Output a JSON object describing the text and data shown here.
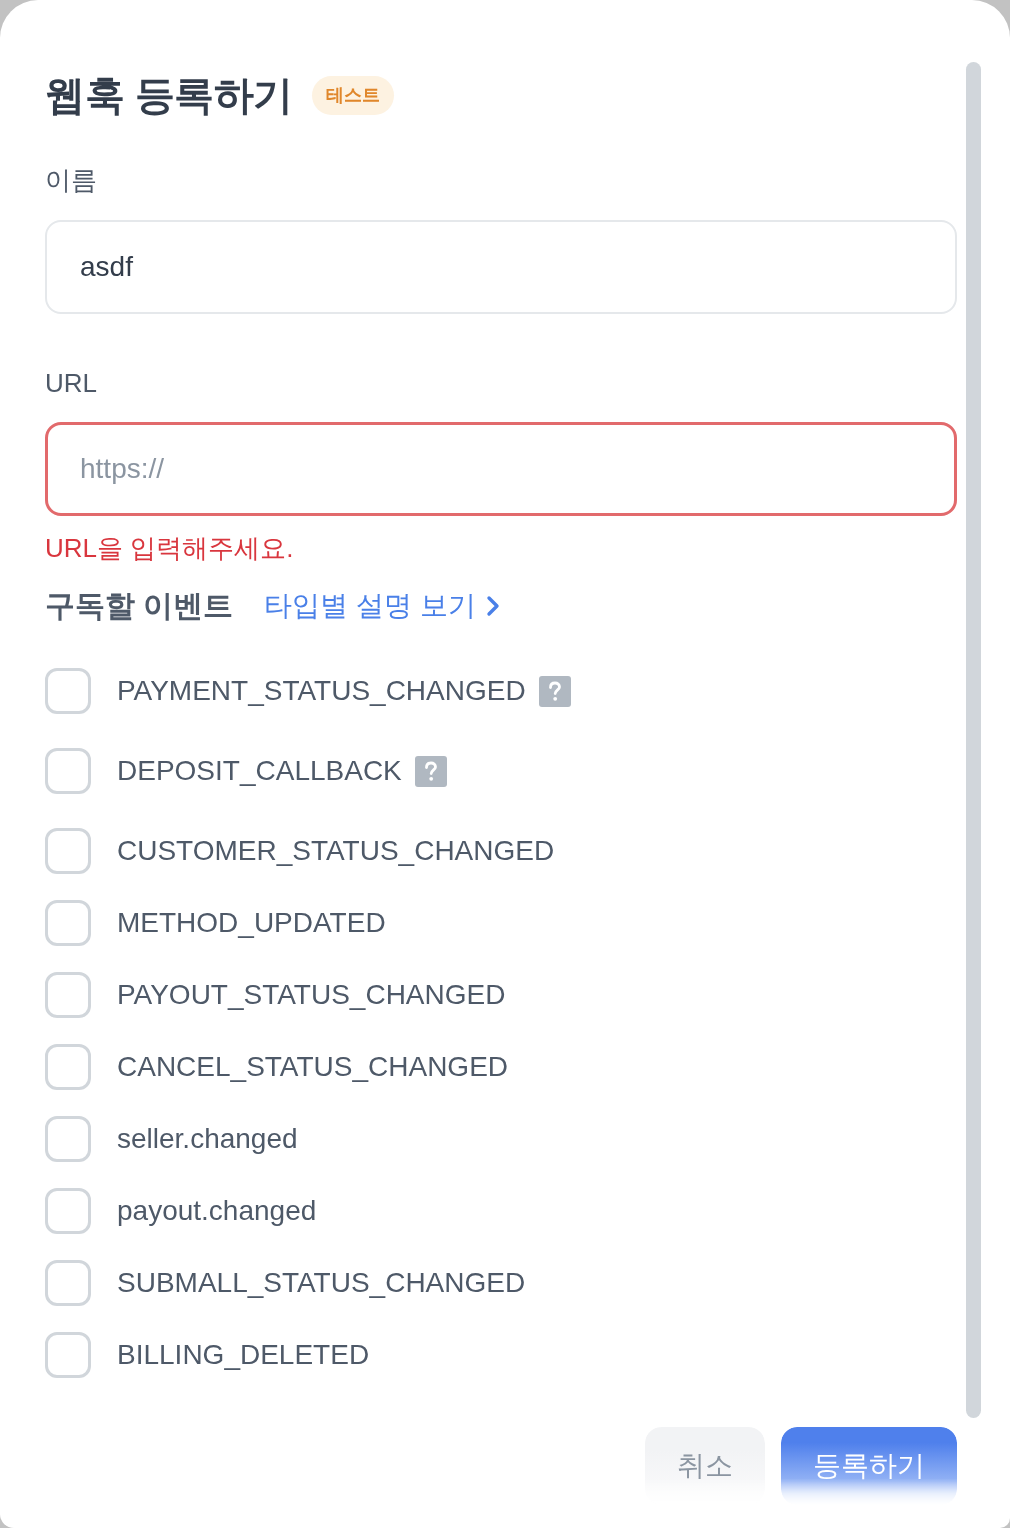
{
  "dialog": {
    "title": "웹훅 등록하기",
    "badge": "테스트"
  },
  "fields": [
    {
      "label": "이름",
      "value": "asdf",
      "invalid": false
    },
    {
      "label": "URL",
      "placeholder": "https://",
      "invalid": true,
      "error": "URL을 입력해주세요."
    }
  ],
  "events": {
    "title": "구독할 이벤트",
    "link": "타입별 설명 보기",
    "items": [
      {
        "label": "PAYMENT_STATUS_CHANGED",
        "checked": false,
        "help": true
      },
      {
        "label": "DEPOSIT_CALLBACK",
        "checked": false,
        "help": true
      },
      {
        "label": "CUSTOMER_STATUS_CHANGED",
        "checked": false,
        "help": false
      },
      {
        "label": "METHOD_UPDATED",
        "checked": false,
        "help": false
      },
      {
        "label": "PAYOUT_STATUS_CHANGED",
        "checked": false,
        "help": false
      },
      {
        "label": "CANCEL_STATUS_CHANGED",
        "checked": false,
        "help": false
      },
      {
        "label": "seller.changed",
        "checked": false,
        "help": false
      },
      {
        "label": "payout.changed",
        "checked": false,
        "help": false
      },
      {
        "label": "SUBMALL_STATUS_CHANGED",
        "checked": false,
        "help": false
      },
      {
        "label": "BILLING_DELETED",
        "checked": false,
        "help": false
      }
    ]
  },
  "buttons": [
    {
      "label": "취소",
      "kind": "secondary"
    },
    {
      "label": "등록하기",
      "kind": "primary"
    }
  ]
}
